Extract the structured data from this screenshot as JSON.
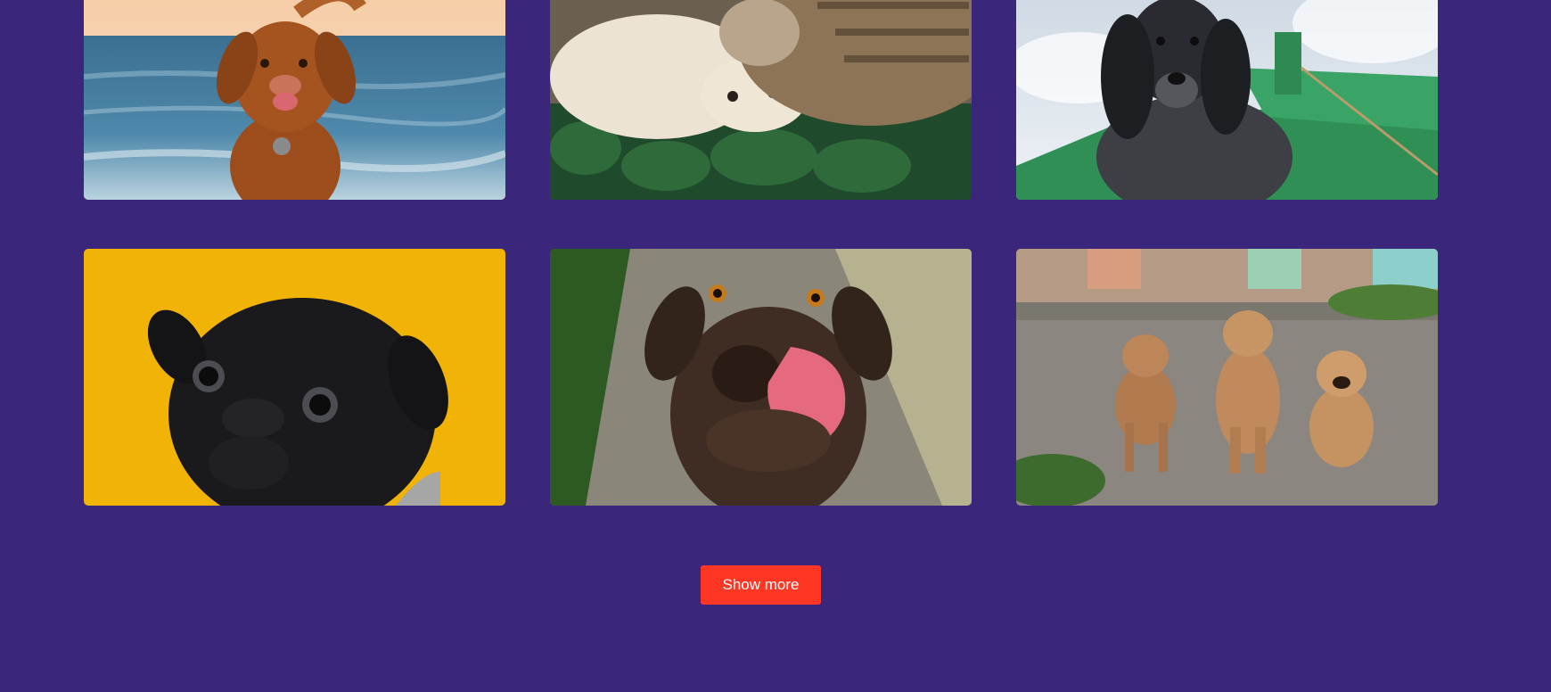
{
  "gallery": {
    "images": [
      {
        "subject": "dog-on-beach-photo"
      },
      {
        "subject": "cat-and-puppy-photo"
      },
      {
        "subject": "spaniel-on-boat-photo"
      },
      {
        "subject": "pug-on-yellow-photo"
      },
      {
        "subject": "labrador-licking-photo"
      },
      {
        "subject": "three-puppies-photo"
      }
    ]
  },
  "actions": {
    "show_more_label": "Show more"
  },
  "colors": {
    "background": "#3a267a",
    "button": "#ff3624",
    "button_text": "#ffffff"
  }
}
